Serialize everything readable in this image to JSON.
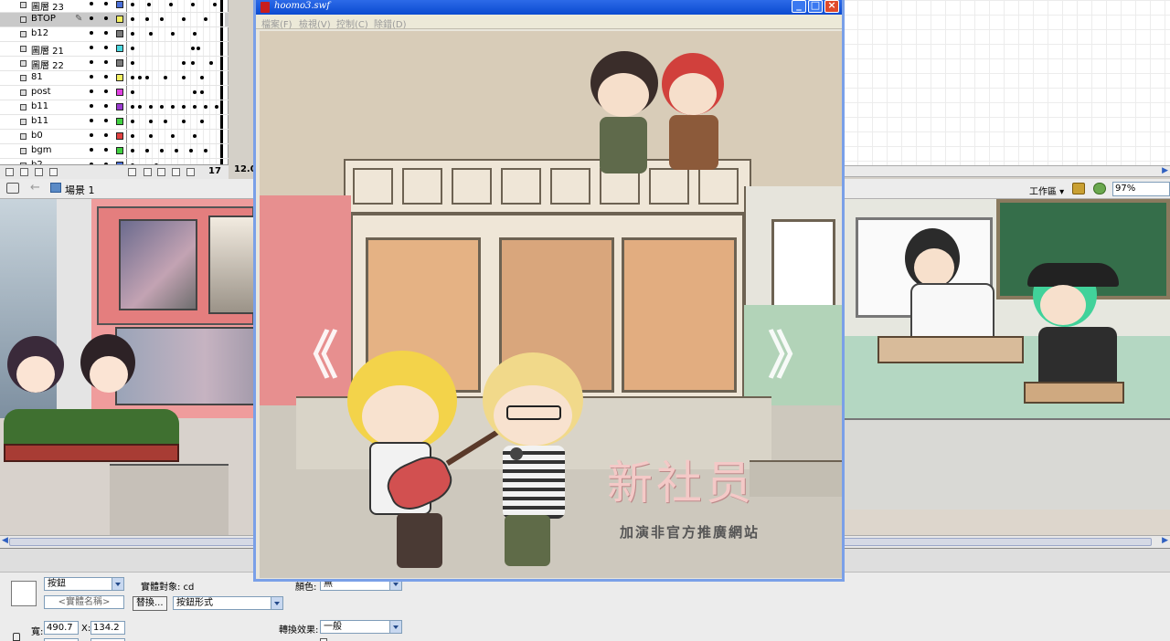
{
  "timeline": {
    "layers": [
      {
        "name": "圖層 23",
        "color": "#4a6fd8",
        "selected": false
      },
      {
        "name": "BTOP",
        "color": "#f4f060",
        "selected": true
      },
      {
        "name": "b12",
        "color": "#7a7a7a",
        "selected": false
      },
      {
        "name": "圖層 21",
        "color": "#4ad8e0",
        "selected": false
      },
      {
        "name": "圖層 22",
        "color": "#7a7a7a",
        "selected": false
      },
      {
        "name": "81",
        "color": "#f4f060",
        "selected": false
      },
      {
        "name": "post",
        "color": "#e040e0",
        "selected": false
      },
      {
        "name": "b11",
        "color": "#9a3ad0",
        "selected": false
      },
      {
        "name": "b11",
        "color": "#40d040",
        "selected": false
      },
      {
        "name": "b0",
        "color": "#e04040",
        "selected": false
      },
      {
        "name": "bgm",
        "color": "#40d040",
        "selected": false
      },
      {
        "name": "b2",
        "color": "#4a6fd8",
        "selected": false
      }
    ],
    "current_frame": "17",
    "fps": "12.0"
  },
  "edit_bar": {
    "scene": "場景 1",
    "workspace": "工作區 ▾",
    "zoom": "97%"
  },
  "player": {
    "title": "hoomo3.swf",
    "menu": [
      "檔案(F)",
      "檢視(V)",
      "控制(C)",
      "除錯(D)"
    ],
    "arrow_left": "《",
    "arrow_right": "》",
    "logo": "新社员",
    "subtitle": "加演非官方推廣網站"
  },
  "properties": {
    "symbol_type": "按鈕",
    "instance_of_label": "實體對象: cd",
    "instance_name_placeholder": "<實體名稱>",
    "swap_label": "替換...",
    "track_option": "按鈕形式",
    "color_label": "顏色:",
    "color_value": "無",
    "blend_label": "轉換效果:",
    "blend_value": "一般",
    "width_label": "寬:",
    "width_value": "490.7",
    "x_label": "X:",
    "x_value": "134.2"
  }
}
